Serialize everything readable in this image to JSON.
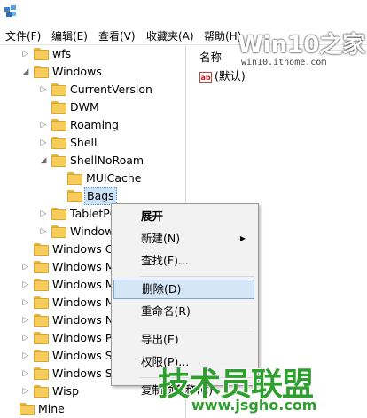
{
  "menubar": {
    "items": [
      "文件(F)",
      "编辑(E)",
      "查看(V)",
      "收藏夹(A)",
      "帮助(H)"
    ]
  },
  "watermark": {
    "logo": "Win10之家",
    "url": "win10.ithome.com"
  },
  "tree": {
    "items": [
      {
        "label": "wfs",
        "indent": 1,
        "expander": "collapsed"
      },
      {
        "label": "Windows",
        "indent": 1,
        "expander": "expanded"
      },
      {
        "label": "CurrentVersion",
        "indent": 2,
        "expander": "collapsed"
      },
      {
        "label": "DWM",
        "indent": 2,
        "expander": "none"
      },
      {
        "label": "Roaming",
        "indent": 2,
        "expander": "collapsed"
      },
      {
        "label": "Shell",
        "indent": 2,
        "expander": "collapsed"
      },
      {
        "label": "ShellNoRoam",
        "indent": 2,
        "expander": "expanded"
      },
      {
        "label": "MUICache",
        "indent": 3,
        "expander": "none"
      },
      {
        "label": "Bags",
        "indent": 3,
        "expander": "none",
        "selected": true
      },
      {
        "label": "TabletPC",
        "indent": 2,
        "expander": "collapsed"
      },
      {
        "label": "Windows",
        "indent": 2,
        "expander": "collapsed"
      },
      {
        "label": "Windows C",
        "indent": 1,
        "expander": "none"
      },
      {
        "label": "Windows M",
        "indent": 1,
        "expander": "collapsed"
      },
      {
        "label": "Windows M",
        "indent": 1,
        "expander": "collapsed"
      },
      {
        "label": "Windows M",
        "indent": 1,
        "expander": "collapsed"
      },
      {
        "label": "Windows N",
        "indent": 1,
        "expander": "collapsed"
      },
      {
        "label": "Windows P",
        "indent": 1,
        "expander": "collapsed"
      },
      {
        "label": "Windows S",
        "indent": 1,
        "expander": "collapsed"
      },
      {
        "label": "Windows S",
        "indent": 1,
        "expander": "collapsed"
      },
      {
        "label": "Wisp",
        "indent": 1,
        "expander": "collapsed"
      },
      {
        "label": "Mine",
        "indent": 0,
        "expander": "none"
      }
    ]
  },
  "list": {
    "column_name": "名称",
    "value_icon": "ab",
    "value_name": "(默认)"
  },
  "context_menu": {
    "items": [
      {
        "label": "展开",
        "bold": true
      },
      {
        "label": "新建(N)",
        "submenu": true
      },
      {
        "label": "查找(F)..."
      },
      {
        "separator": true
      },
      {
        "label": "删除(D)",
        "highlighted": true
      },
      {
        "label": "重命名(R)"
      },
      {
        "separator": true
      },
      {
        "label": "导出(E)"
      },
      {
        "label": "权限(P)..."
      },
      {
        "separator": true
      },
      {
        "label": "复制项名称(C)"
      }
    ]
  },
  "branding": {
    "name": "技术员联盟",
    "url": "www.jsgho.com"
  },
  "colors": {
    "folder": "#f6cd5a",
    "selection": "#cce4f7",
    "menu_highlight": "#d5e6f7",
    "brand_green": "#2e9e2e"
  }
}
